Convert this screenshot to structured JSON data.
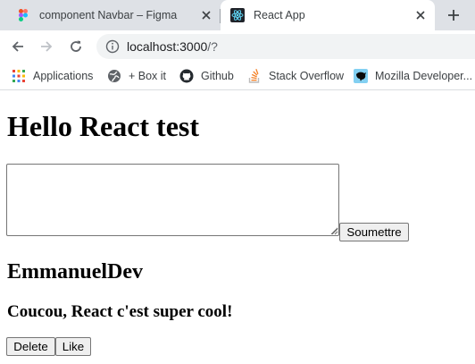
{
  "browser": {
    "tabs": [
      {
        "title": "component Navbar – Figma",
        "favicon": "figma-icon",
        "active": false
      },
      {
        "title": "React App",
        "favicon": "react-icon",
        "active": true
      }
    ],
    "url": {
      "host": "localhost:3000",
      "path": "/?"
    },
    "bookmarks": [
      {
        "label": "Applications",
        "icon": "apps-grid-icon"
      },
      {
        "label": "+ Box it",
        "icon": "globe-icon"
      },
      {
        "label": "Github",
        "icon": "github-icon"
      },
      {
        "label": "Stack Overflow",
        "icon": "stackoverflow-icon"
      },
      {
        "label": "Mozilla Developer...",
        "icon": "mdn-icon"
      }
    ]
  },
  "page": {
    "heading": "Hello React test",
    "textarea_value": "",
    "submit_label": "Soumettre",
    "author": "EmmanuelDev",
    "message": "Coucou, React c'est super cool!",
    "delete_label": "Delete",
    "like_label": "Like"
  },
  "colors": {
    "tabstrip_bg": "#dee1e6",
    "omnibox_bg": "#f1f3f4",
    "text": "#3c4043"
  }
}
